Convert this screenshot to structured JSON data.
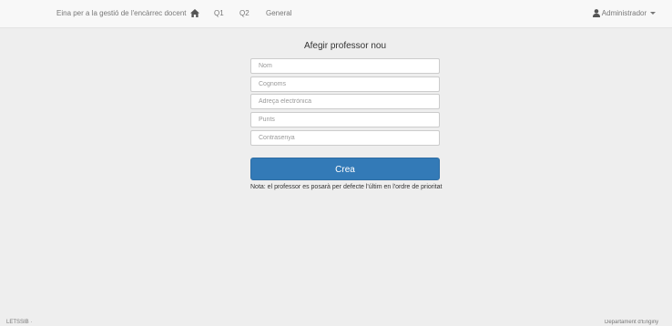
{
  "navbar": {
    "brand": "Eina per a la gestió de l'encàrrec docent",
    "home_icon": "home-icon",
    "links": [
      "Q1",
      "Q2",
      "General"
    ],
    "user_icon": "user-icon",
    "user_label": "Administrador"
  },
  "form": {
    "title": "Afegir professor nou",
    "fields": {
      "nom": "Nom",
      "cognoms": "Cognoms",
      "email": "Adreça electrònica",
      "punts": "Punts",
      "contrasenya": "Contrasenya"
    },
    "submit_label": "Crea",
    "note": "Nota: el professor es posarà per defecte l'últim en l'ordre de prioritat"
  },
  "footer": {
    "left": "LETSSIB ·",
    "right": "Departament d'Enginy"
  },
  "colors": {
    "primary": "#337ab7",
    "background": "#eeeeee",
    "navbar": "#f8f8f8"
  }
}
